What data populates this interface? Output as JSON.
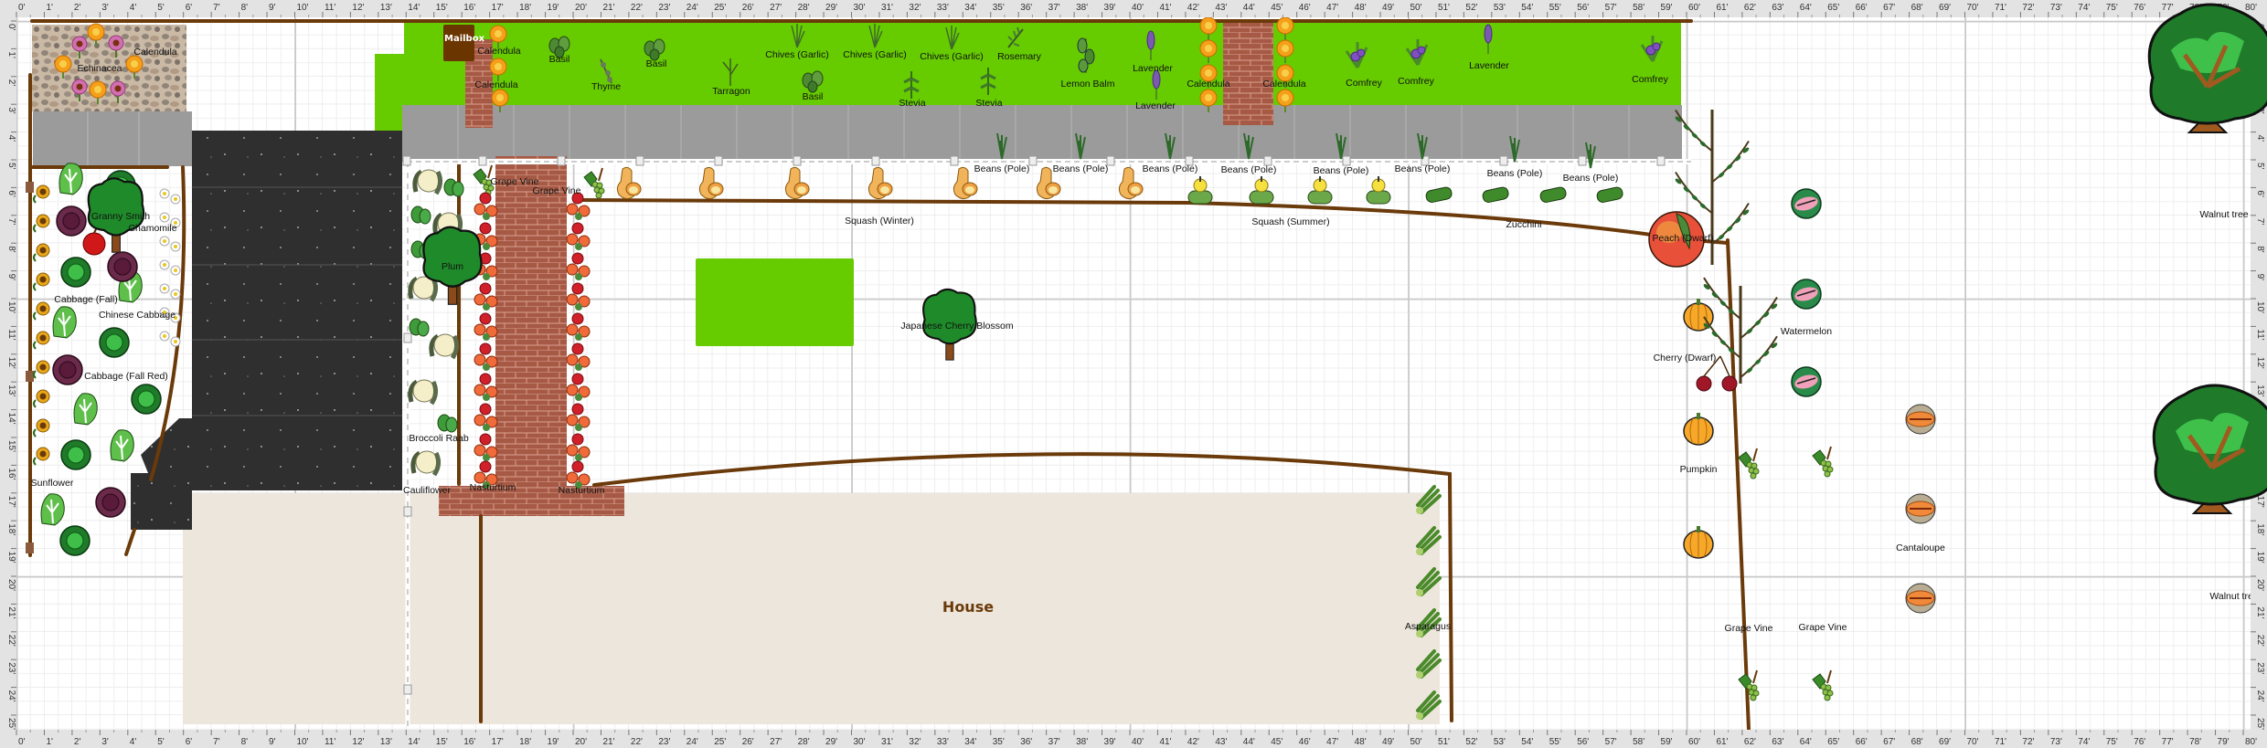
{
  "rulers": {
    "unit": "'",
    "x_max": 80,
    "y_max": 25
  },
  "structures": {
    "house_label": "House",
    "mailbox_label": "Mailbox"
  },
  "plant_labels": [
    "Calendula",
    "Echinacea",
    "Calendula",
    "Calendula",
    "Basil",
    "Thyme",
    "Basil",
    "Tarragon",
    "Chives (Garlic)",
    "Basil",
    "Chives (Garlic)",
    "Stevia",
    "Chives (Garlic)",
    "Rosemary",
    "Stevia",
    "Lemon Balm",
    "Lavender",
    "Lavender",
    "Calendula",
    "Calendula",
    "Comfrey",
    "Comfrey",
    "Lavender",
    "Comfrey",
    "Beans (Pole)",
    "Beans (Pole)",
    "Beans (Pole)",
    "Beans (Pole)",
    "Beans (Pole)",
    "Beans (Pole)",
    "Beans (Pole)",
    "Beans (Pole)",
    "Squash (Winter)",
    "Squash (Summer)",
    "Zucchini",
    "Grape Vine",
    "Grape Vine",
    "Granny Smith",
    "Chamomile",
    "Cabbage (Fall)",
    "Chinese Cabbage",
    "Cabbage (Fall Red)",
    "Sunflower",
    "Plum",
    "Broccoli Raab",
    "Cauliflower",
    "Nasturtium",
    "Nasturtium",
    "Japanese Cherry Blossom",
    "Asparagus",
    "Peach (Dwarf)",
    "Watermelon",
    "Cherry (Dwarf)",
    "Pumpkin",
    "Grape Vine",
    "Grape Vine",
    "Cantaloupe",
    "Walnut tree",
    "Walnut tree"
  ],
  "icon_types": [
    "calendula-icon",
    "echinacea-icon",
    "basil-icon",
    "thyme-icon",
    "tarragon-icon",
    "chives-icon",
    "stevia-icon",
    "rosemary-icon",
    "lemon-balm-icon",
    "lavender-icon",
    "comfrey-icon",
    "beans-icon",
    "winter-squash-icon",
    "summer-squash-icon",
    "zucchini-icon",
    "grape-vine-icon",
    "cabbage-icon",
    "red-cabbage-icon",
    "chinese-cabbage-icon",
    "sunflower-icon",
    "chamomile-icon",
    "apple-icon",
    "cauliflower-icon",
    "broccoli-raab-icon",
    "nasturtium-icon",
    "asparagus-icon",
    "peach-icon",
    "watermelon-icon",
    "cherry-icon",
    "pumpkin-icon",
    "cantaloupe-icon",
    "tree-icon",
    "walnut-tree-icon"
  ],
  "colors": {
    "lawn": "#66cc00",
    "pavers": "#9b9b9b",
    "asphalt": "#2f2f2f",
    "brick": "#a65a45",
    "house": "#ede6dc",
    "fence": "#6b3a0a",
    "ruler": "#e3e3e3",
    "grid": "#dedede"
  }
}
